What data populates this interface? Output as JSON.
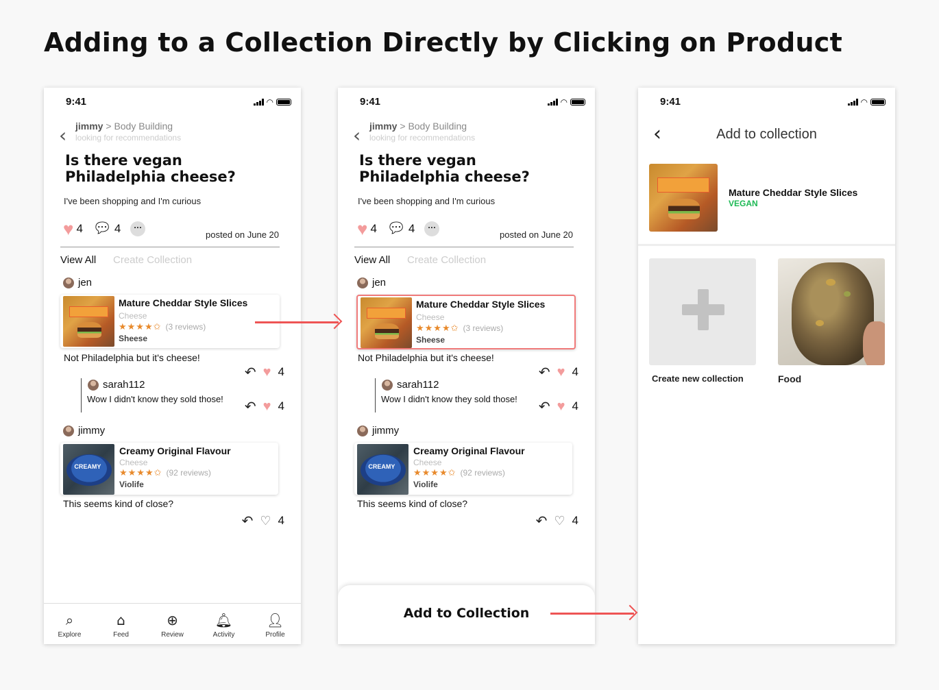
{
  "page_title": "Adding to a Collection Directly by Clicking on Product",
  "status": {
    "time": "9:41"
  },
  "post": {
    "author": "jimmy",
    "separator": ">",
    "category": "Body Building",
    "subtitle": "looking for recommendations",
    "title": "Is there vegan Philadelphia cheese?",
    "body": "I've been shopping and I'm curious",
    "likes": "4",
    "comments": "4",
    "more": "···",
    "posted": "posted on June 20"
  },
  "tabs": {
    "view_all": "View All",
    "create_collection": "Create Collection"
  },
  "thread": [
    {
      "user": "jen",
      "product": {
        "name": "Mature Cheddar Style Slices",
        "category": "Cheese",
        "stars": "★★★★✩",
        "rating": 4.5,
        "reviews": "(3 reviews)",
        "brand": "Sheese"
      },
      "comment": "Not Philadelphia but it's cheese!",
      "likes": "4",
      "reply": {
        "user": "sarah112",
        "text": "Wow I didn't know they sold those!",
        "likes": "4"
      }
    },
    {
      "user": "jimmy",
      "product": {
        "name": "Creamy Original Flavour",
        "category": "Cheese",
        "stars": "★★★★✩",
        "rating": 4.5,
        "reviews": "(92 reviews)",
        "brand": "Violife",
        "image_text": "CREAMY"
      },
      "comment": "This seems kind of close?",
      "likes": "4"
    }
  ],
  "tabbar": [
    {
      "label": "Explore",
      "icon": "search-icon"
    },
    {
      "label": "Feed",
      "icon": "home-icon"
    },
    {
      "label": "Review",
      "icon": "plus-circle-icon"
    },
    {
      "label": "Activity",
      "icon": "bell-icon"
    },
    {
      "label": "Profile",
      "icon": "user-icon"
    }
  ],
  "sheet": {
    "button": "Add to Collection"
  },
  "collection_screen": {
    "title": "Add to collection",
    "product_name": "Mature Cheddar Style Slices",
    "product_tag": "VEGAN",
    "new_label": "Create new collection",
    "food_label": "Food"
  },
  "colors": {
    "accent": "#ee5454",
    "heart": "#f39c9c",
    "star": "#e88a2c",
    "vegan": "#1db954"
  }
}
